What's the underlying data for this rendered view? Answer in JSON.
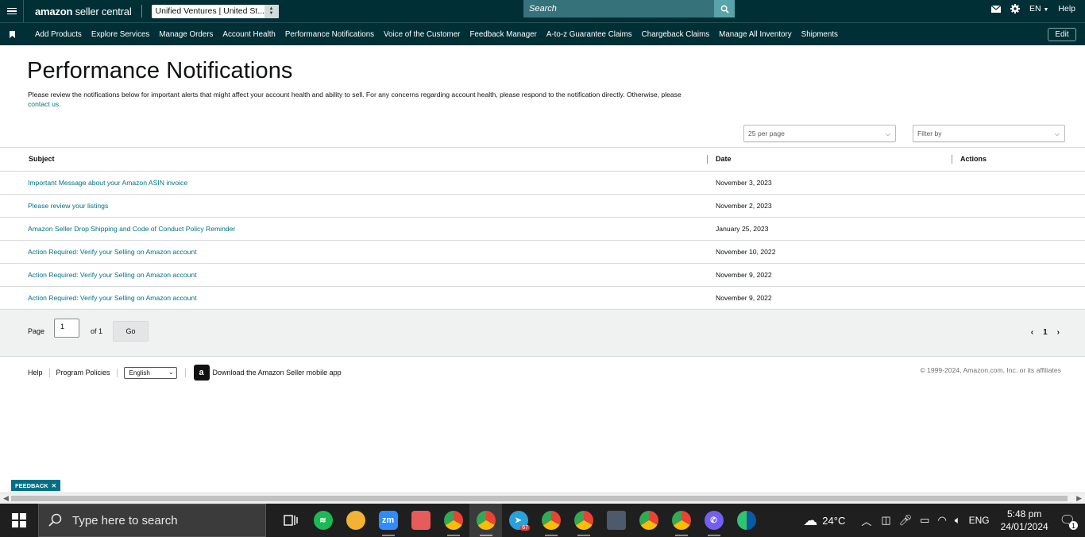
{
  "topbar": {
    "logo_main": "amazon",
    "logo_sub": " seller central",
    "account": "Unified Ventures | United St...",
    "search_placeholder": "Search",
    "language": "EN",
    "help": "Help"
  },
  "nav": {
    "items": [
      "Add Products",
      "Explore Services",
      "Manage Orders",
      "Account Health",
      "Performance Notifications",
      "Voice of the Customer",
      "Feedback Manager",
      "A-to-z Guarantee Claims",
      "Chargeback Claims",
      "Manage All Inventory",
      "Shipments"
    ],
    "edit": "Edit"
  },
  "page": {
    "title": "Performance Notifications",
    "intro": "Please review the notifications below for important alerts that might affect your account health and ability to sell. For any concerns regarding account health, please respond to the notification directly. Otherwise, please",
    "contact_link": "contact us.",
    "per_page": "25 per page",
    "filter_placeholder": "Filter by"
  },
  "table": {
    "headers": {
      "subject": "Subject",
      "date": "Date",
      "actions": "Actions"
    },
    "rows": [
      {
        "subject": "Important Message about your Amazon ASIN invoice",
        "date": "November 3, 2023"
      },
      {
        "subject": "Please review your listings",
        "date": "November 2, 2023"
      },
      {
        "subject": "Amazon Seller Drop Shipping and Code of Conduct Policy Reminder",
        "date": "January 25, 2023"
      },
      {
        "subject": "Action Required: Verify your Selling on Amazon account",
        "date": "November 10, 2022"
      },
      {
        "subject": "Action Required: Verify your Selling on Amazon account",
        "date": "November 9, 2022"
      },
      {
        "subject": "Action Required: Verify your Selling on Amazon account",
        "date": "November 9, 2022"
      }
    ]
  },
  "pager": {
    "page_label": "Page",
    "page_value": "1",
    "of_label": "of 1",
    "go": "Go",
    "current": "1"
  },
  "footer": {
    "help": "Help",
    "program_policies": "Program Policies",
    "language": "English",
    "app_text": "Download the Amazon Seller mobile app",
    "copyright": "© 1999-2024, Amazon.com, Inc. or its affiliates"
  },
  "feedback": "FEEDBACK",
  "taskbar": {
    "search_placeholder": "Type here to search",
    "temperature": "24°C",
    "lang": "ENG",
    "time": "5:48 pm",
    "date": "24/01/2024",
    "telegram_badge": "67",
    "notif_count": "1"
  }
}
